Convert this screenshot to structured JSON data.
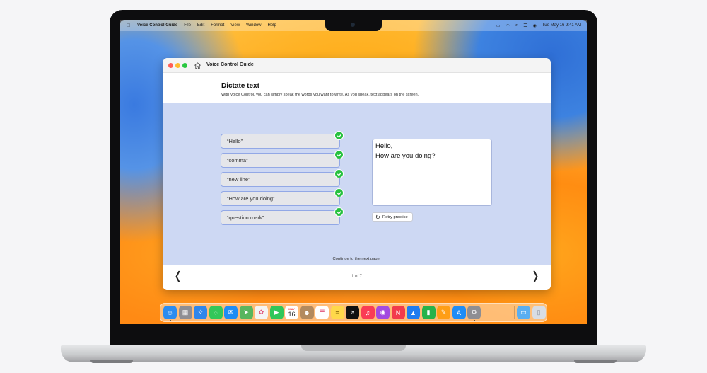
{
  "menubar": {
    "app_name": "Voice Control Guide",
    "menus": [
      "File",
      "Edit",
      "Format",
      "View",
      "Window",
      "Help"
    ],
    "clock": "Tue May 16  9:41 AM"
  },
  "window": {
    "title": "Voice Control Guide",
    "heading": "Dictate text",
    "subheading": "With Voice Control, you can simply speak the words you want to write. As you speak, text appears on the screen.",
    "phrases": [
      "“Hello”",
      "“comma”",
      "“new line”",
      "“How are you doing”",
      "“question mark”"
    ],
    "phrases_completed": [
      true,
      true,
      true,
      true,
      true
    ],
    "dictated_lines": [
      "Hello,",
      "How are you doing?"
    ],
    "retry_label": "Retry practice",
    "continue_text": "Continue to the next page.",
    "page_indicator": "1 of 7",
    "prev_glyph": "❬",
    "next_glyph": "❭"
  },
  "dock": {
    "apps": [
      {
        "icon": "finder-icon",
        "color": "#2b8cf0"
      },
      {
        "icon": "launchpad-icon",
        "color": "#8e8e93"
      },
      {
        "icon": "safari-icon",
        "color": "#2f86ea"
      },
      {
        "icon": "messages-icon",
        "color": "#33c759"
      },
      {
        "icon": "mail-icon",
        "color": "#1e8cf5"
      },
      {
        "icon": "maps-icon",
        "color": "#59b55e"
      },
      {
        "icon": "photos-icon",
        "color": "#f4f4f4"
      },
      {
        "icon": "facetime-icon",
        "color": "#2fc65a"
      },
      {
        "icon": "calendar-icon",
        "color": "#ffffff"
      },
      {
        "icon": "contacts-icon",
        "color": "#b38a5e"
      },
      {
        "icon": "reminders-icon",
        "color": "#ffffff"
      },
      {
        "icon": "notes-icon",
        "color": "#ffd84a"
      },
      {
        "icon": "tv-icon",
        "color": "#111111"
      },
      {
        "icon": "music-icon",
        "color": "#fa3c55"
      },
      {
        "icon": "podcasts-icon",
        "color": "#a24be0"
      },
      {
        "icon": "news-icon",
        "color": "#f23a4c"
      },
      {
        "icon": "keynote-icon",
        "color": "#1f7cf0"
      },
      {
        "icon": "numbers-icon",
        "color": "#27b24a"
      },
      {
        "icon": "pages-icon",
        "color": "#ff9e16"
      },
      {
        "icon": "app-store-icon",
        "color": "#1e8cf5"
      },
      {
        "icon": "system-settings-icon",
        "color": "#8e8e93"
      },
      {
        "icon": "downloads-folder-icon",
        "color": "#5aaef0"
      },
      {
        "icon": "trash-icon",
        "color": "#d8dde3"
      }
    ],
    "calendar_day": "16",
    "calendar_month": "MAY",
    "tv_label": "tv"
  }
}
